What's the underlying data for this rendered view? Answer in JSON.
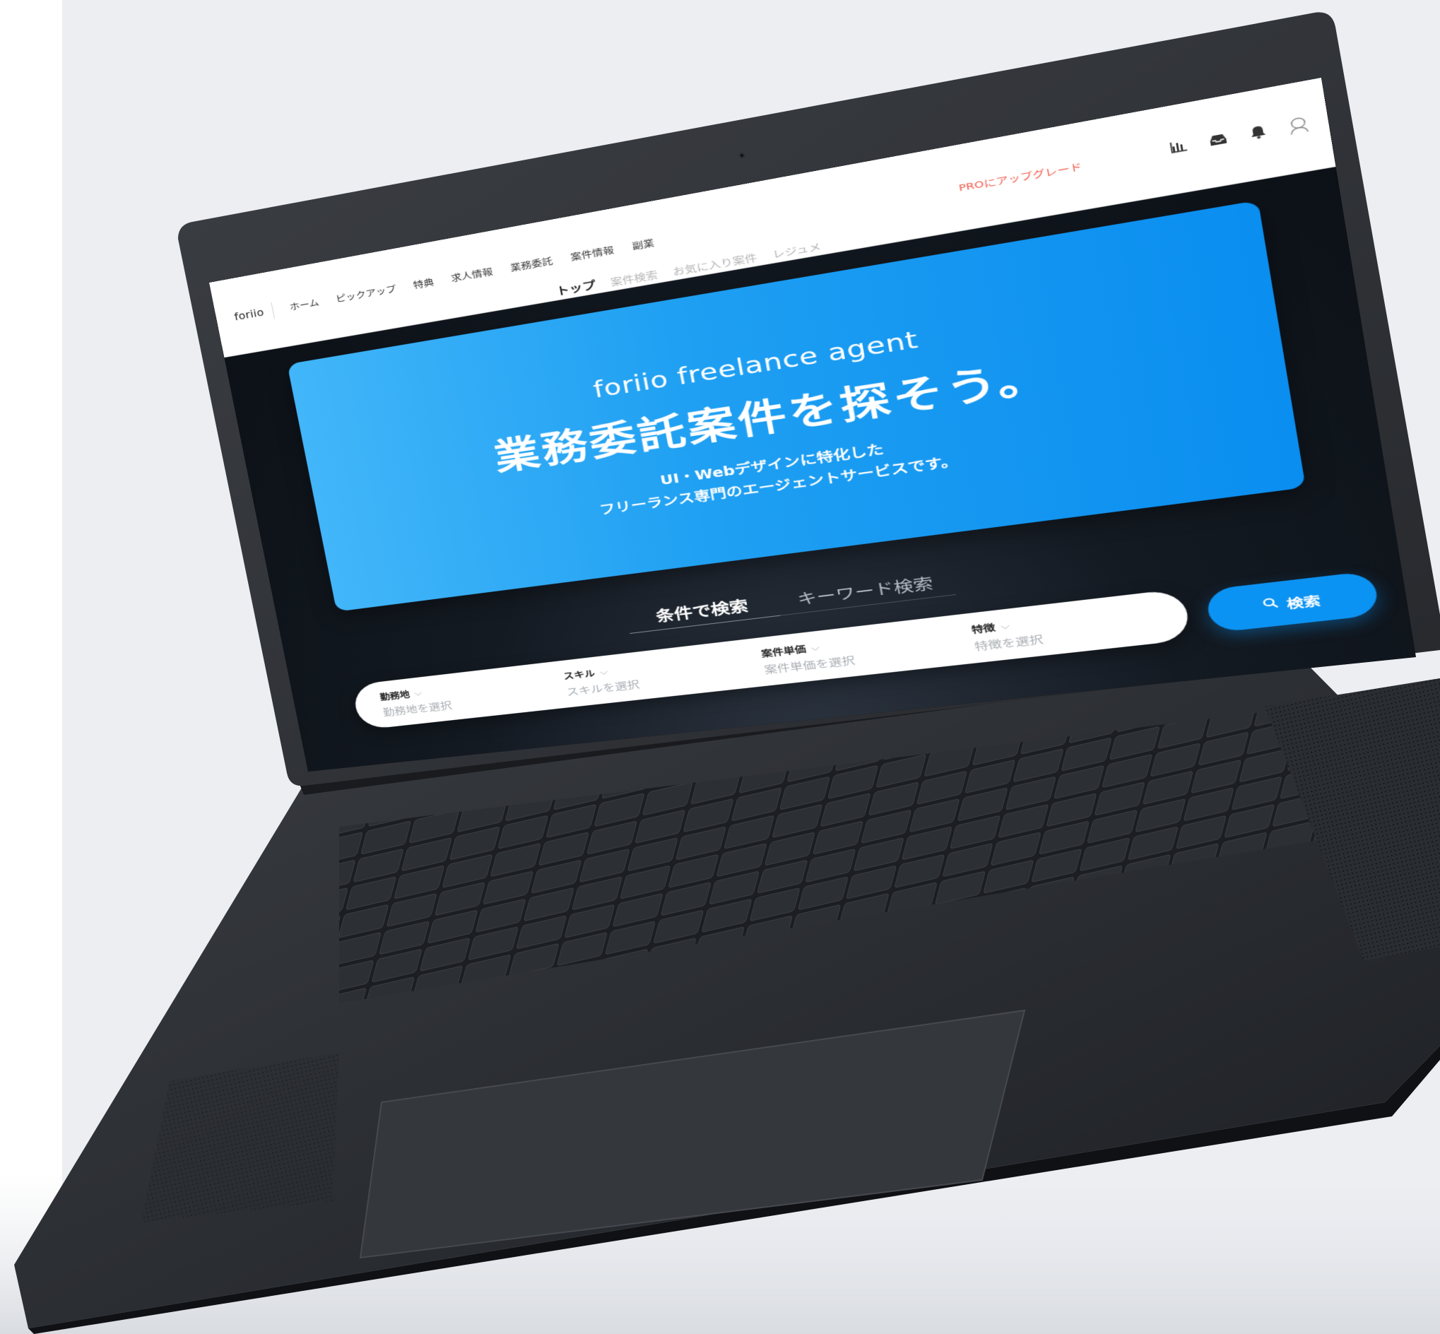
{
  "app": {
    "logo": "foriio",
    "nav": [
      "ホーム",
      "ピックアップ",
      "特典",
      "求人情報",
      "業務委託",
      "案件情報",
      "副業"
    ],
    "upgrade_label": "PROにアップグレード",
    "icons": [
      "chart-icon",
      "inbox-icon",
      "bell-icon",
      "profile-avatar-icon"
    ]
  },
  "subnav": {
    "items": [
      "トップ",
      "案件検索",
      "お気に入り案件",
      "レジュメ"
    ],
    "active_index": 0
  },
  "hero": {
    "brand": "foriio freelance agent",
    "title": "業務委託案件を探そう。",
    "subtitle_line1": "UI・Webデザインに特化した",
    "subtitle_line2": "フリーランス専門のエージェントサービスです。"
  },
  "search": {
    "tabs": [
      "条件で検索",
      "キーワード検索"
    ],
    "active_tab": 0,
    "fields": [
      {
        "label": "勤務地",
        "placeholder": "勤務地を選択"
      },
      {
        "label": "スキル",
        "placeholder": "スキルを選択"
      },
      {
        "label": "案件単価",
        "placeholder": "案件単価を選択"
      },
      {
        "label": "特徴",
        "placeholder": "特徴を選択"
      }
    ],
    "button_label": "検索"
  },
  "colors": {
    "accent": "#0b93f3",
    "upgrade": "#f15a4a",
    "hero_gradient_start": "#42b6f9",
    "hero_gradient_end": "#0a8ef0"
  }
}
